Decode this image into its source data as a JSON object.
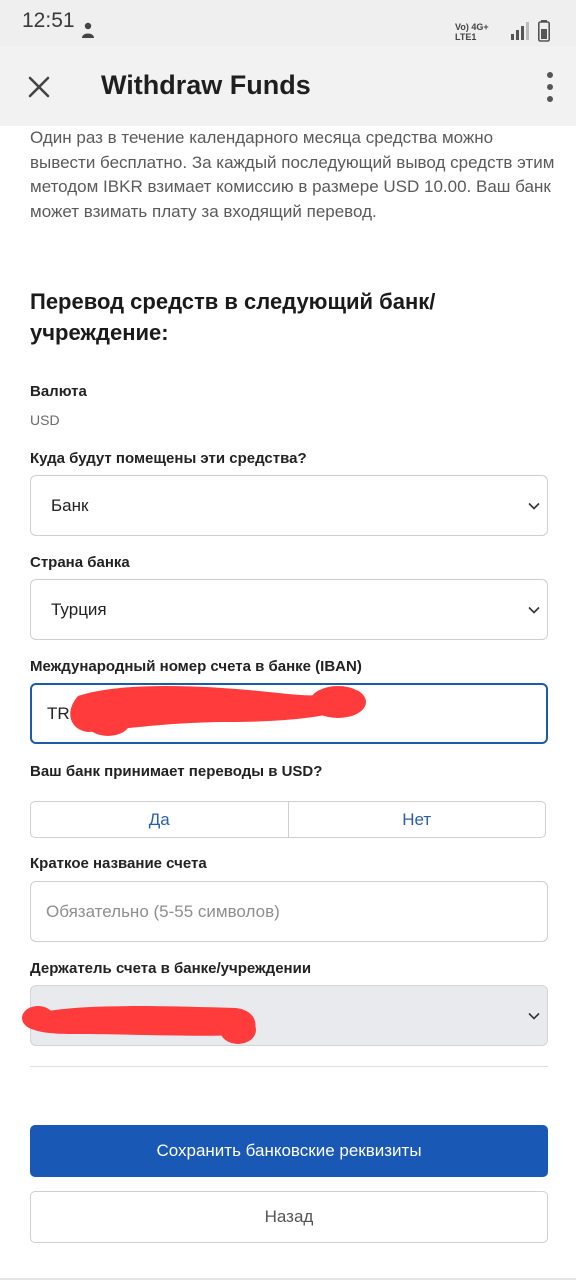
{
  "status_bar": {
    "time": "12:51",
    "network_top": "Vo) 4G+",
    "network_bottom": "LTE1",
    "icons": [
      "person-icon",
      "signal-icon",
      "battery-icon"
    ]
  },
  "app_bar": {
    "title": "Withdraw Funds",
    "icons": [
      "close-icon",
      "more-vertical-icon"
    ]
  },
  "intro_text": "Один раз в течение календарного месяца средства можно вывести бесплатно. За каждый последующий вывод средств этим методом IBKR взимает комиссию в размере USD 10.00. Ваш банк может взимать плату за входящий перевод.",
  "section_heading": "Перевод средств в следующий банк/ учреждение:",
  "currency": {
    "label": "Валюта",
    "value": "USD"
  },
  "destination": {
    "label": "Куда будут помещены эти средства?",
    "selected": "Банк"
  },
  "bank_country": {
    "label": "Страна банка",
    "selected": "Турция"
  },
  "iban": {
    "label": "Международный номер счета в банке (IBAN)",
    "value": "TR"
  },
  "accepts_usd": {
    "label": "Ваш банк принимает переводы в USD?",
    "options": [
      "Да",
      "Нет"
    ]
  },
  "account_short_name": {
    "label": "Краткое название счета",
    "placeholder": "Обязательно (5-55 символов)"
  },
  "account_holder": {
    "label": "Держатель счета в банке/учреждении",
    "selected": ""
  },
  "buttons": {
    "save": "Сохранить банковские реквизиты",
    "back": "Назад"
  },
  "colors": {
    "primary": "#1a58b5",
    "focus_border": "#1f5aa6",
    "toggle_text": "#2a5ea8",
    "redaction": "#ff3b3b"
  }
}
